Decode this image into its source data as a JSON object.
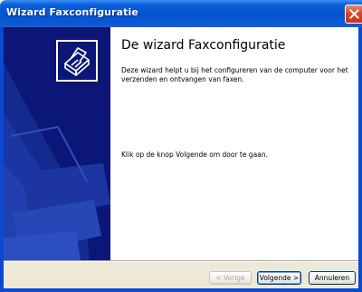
{
  "window": {
    "title": "Wizard Faxconfiguratie"
  },
  "titlebar": {
    "close_icon": "close-icon"
  },
  "side_panel": {
    "logo_icon": "fax-machine-icon",
    "background_icon": "fax-machine-icon"
  },
  "content": {
    "heading": "De wizard Faxconfiguratie",
    "description": "Deze wizard helpt u bij het configureren van de computer voor het verzenden en ontvangen van faxen.",
    "instruction": "Klik op de knop Volgende om door te gaan."
  },
  "buttons": {
    "back_label": "< Vorige",
    "next_label": "Volgende >",
    "cancel_label": "Annuleren"
  },
  "colors": {
    "titlebar": "#0453d0",
    "side_panel": "#0b1677",
    "dialog_background": "#ece9d8"
  }
}
